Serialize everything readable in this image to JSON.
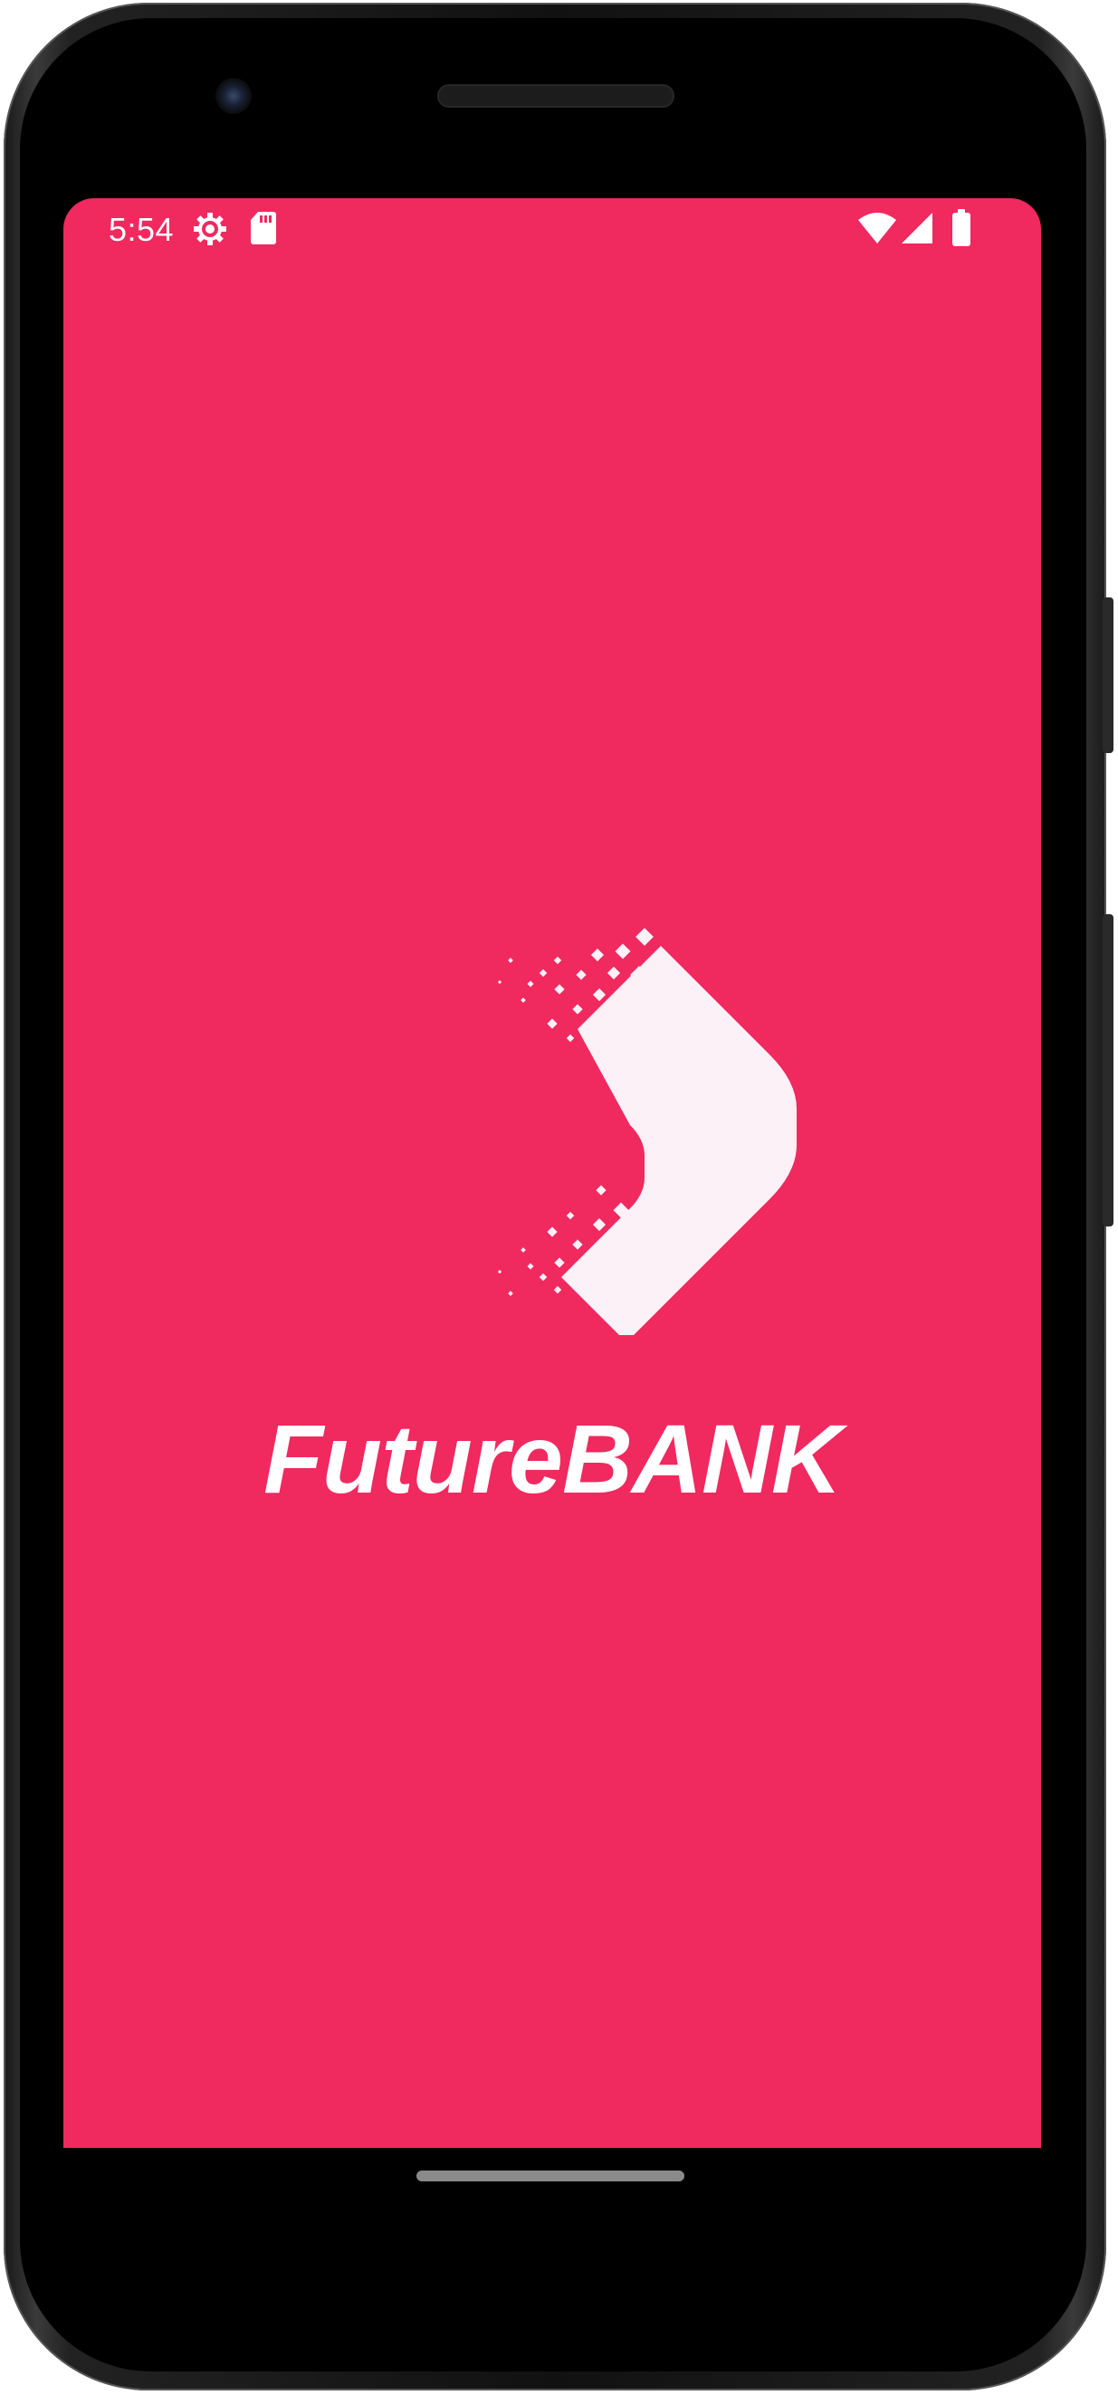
{
  "status_bar": {
    "time": "5:54",
    "icons": [
      "settings-gear-icon",
      "sd-card-icon",
      "wifi-icon",
      "cell-signal-icon",
      "battery-icon"
    ]
  },
  "app": {
    "name": "FutureBANK",
    "logo": "chevron-pixel-logo"
  },
  "colors": {
    "background": "#f0295f",
    "foreground": "#ffffff",
    "logo_fill": "#fbf1f6"
  }
}
